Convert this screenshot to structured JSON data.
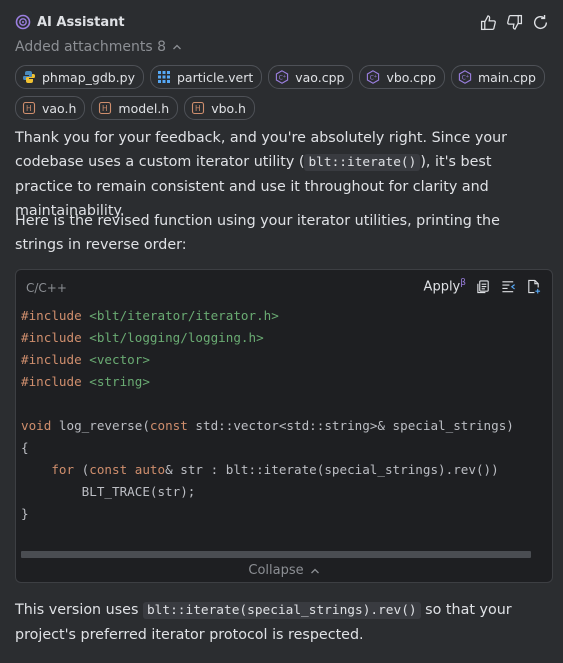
{
  "header": {
    "title": "AI Assistant",
    "icons": [
      "sparkle-logo-icon",
      "thumbs-up-icon",
      "thumbs-down-icon",
      "refresh-icon"
    ]
  },
  "attachments": {
    "label": "Added attachments 8",
    "files": [
      {
        "name": "phmap_gdb.py",
        "icon": "python-icon"
      },
      {
        "name": "particle.vert",
        "icon": "grid-icon"
      },
      {
        "name": "vao.cpp",
        "icon": "cpp-icon"
      },
      {
        "name": "vbo.cpp",
        "icon": "cpp-icon"
      },
      {
        "name": "main.cpp",
        "icon": "cpp-icon"
      },
      {
        "name": "vao.h",
        "icon": "header-icon"
      },
      {
        "name": "model.h",
        "icon": "header-icon"
      },
      {
        "name": "vbo.h",
        "icon": "header-icon"
      }
    ]
  },
  "message": {
    "p1_a": "Thank you for your feedback, and you're absolutely right. Since your codebase uses a custom iterator utility (",
    "p1_code": "blt::iterate()",
    "p1_b": "), it's best practice to remain consistent and use it throughout for clarity and maintainability.",
    "p2": "Here is the revised function using your iterator utilities, printing the strings in reverse order:",
    "p3_a": "This version uses ",
    "p3_code": "blt::iterate(special_strings).rev()",
    "p3_b": " so that your project's preferred iterator protocol is respected."
  },
  "code_block": {
    "language": "C/C++",
    "apply_label": "Apply",
    "apply_sup": "β",
    "collapse_label": "Collapse",
    "lines": [
      "#include <blt/iterator/iterator.h>",
      "#include <blt/logging/logging.h>",
      "#include <vector>",
      "#include <string>",
      "",
      "void log_reverse(const std::vector<std::string>& special_strings)",
      "{",
      "    for (const auto& str : blt::iterate(special_strings).rev())",
      "        BLT_TRACE(str);",
      "}"
    ]
  },
  "colors": {
    "background": "#2b2d30",
    "code_bg": "#1e1f22",
    "keyword": "#cf8e6d",
    "string": "#6aab73",
    "accent": "#9b7fe0"
  }
}
